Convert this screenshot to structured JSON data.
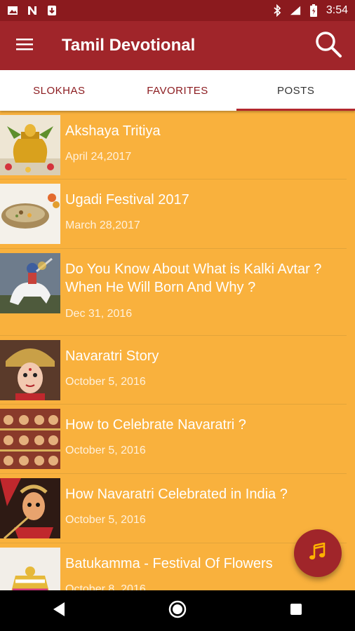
{
  "status_bar": {
    "time": "3:54",
    "icons": [
      "image-icon",
      "n-icon",
      "download-icon",
      "bluetooth-icon",
      "signal-icon",
      "battery-icon"
    ]
  },
  "app_bar": {
    "title": "Tamil Devotional",
    "menu_icon": "hamburger-menu-icon",
    "search_icon": "search-icon"
  },
  "tabs": [
    {
      "label": "SLOKHAS",
      "active": false
    },
    {
      "label": "FAVORITES",
      "active": false
    },
    {
      "label": "POSTS",
      "active": true
    }
  ],
  "posts": [
    {
      "title": "Akshaya Tritiya",
      "date": "April 24,2017"
    },
    {
      "title": "Ugadi Festival 2017",
      "date": "March 28,2017"
    },
    {
      "title": "Do You Know About What is Kalki Avtar ? When He Will Born And Why ?",
      "date": "Dec 31, 2016"
    },
    {
      "title": "Navaratri Story",
      "date": "October 5, 2016"
    },
    {
      "title": "How to Celebrate Navaratri ?",
      "date": "October 5, 2016"
    },
    {
      "title": "How Navaratri Celebrated in India ?",
      "date": "October 5, 2016"
    },
    {
      "title": "Batukamma - Festival Of Flowers",
      "date": "October 8, 2016"
    }
  ],
  "fab": {
    "icon": "music-note-icon"
  },
  "nav_bar": {
    "icons": [
      "back-icon",
      "home-icon",
      "recents-icon"
    ]
  },
  "colors": {
    "primary": "#A0252A",
    "status": "#8B1A1E",
    "list_bg": "#F9B13D",
    "accent": "#FFB300"
  }
}
